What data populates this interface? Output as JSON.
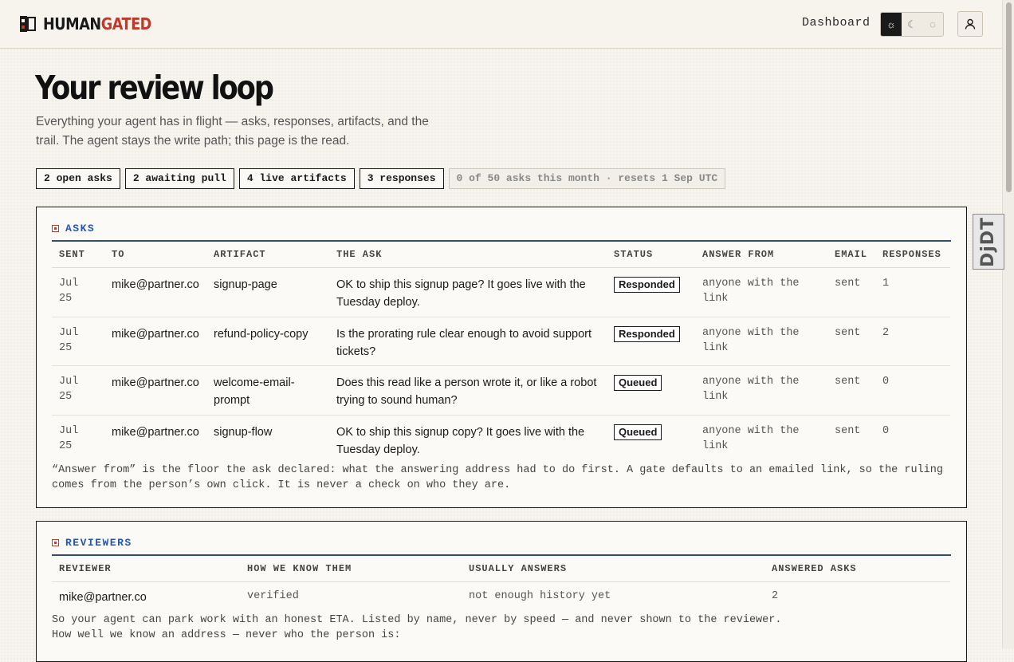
{
  "brand": {
    "part1": "HUMAN",
    "part2": "GATED"
  },
  "nav": {
    "dashboard": "Dashboard"
  },
  "theme": {
    "light": "☼",
    "dark": "☾",
    "system": "◌"
  },
  "page": {
    "title": "Your review loop",
    "lede": "Everything your agent has in flight — asks, responses, artifacts, and the trail. The agent stays the write path; this page is the read."
  },
  "chips": [
    "2 open asks",
    "2 awaiting pull",
    "4 live artifacts",
    "3 responses"
  ],
  "quota": "0 of 50 asks this month · resets 1 Sep UTC",
  "asks": {
    "title": "ASKS",
    "columns": [
      "SENT",
      "TO",
      "ARTIFACT",
      "THE ASK",
      "STATUS",
      "ANSWER FROM",
      "EMAIL",
      "RESPONSES"
    ],
    "rows": [
      {
        "sent": "Jul 25",
        "to": "mike@partner.co",
        "artifact": "signup-page",
        "ask": "OK to ship this signup page? It goes live with the Tuesday deploy.",
        "status": "Responded",
        "answer_from": "anyone with the link",
        "email": "sent",
        "responses": "1"
      },
      {
        "sent": "Jul 25",
        "to": "mike@partner.co",
        "artifact": "refund-policy-copy",
        "ask": "Is the prorating rule clear enough to avoid support tickets?",
        "status": "Responded",
        "answer_from": "anyone with the link",
        "email": "sent",
        "responses": "2"
      },
      {
        "sent": "Jul 25",
        "to": "mike@partner.co",
        "artifact": "welcome-email-prompt",
        "ask": "Does this read like a person wrote it, or like a robot trying to sound human?",
        "status": "Queued",
        "answer_from": "anyone with the link",
        "email": "sent",
        "responses": "0"
      },
      {
        "sent": "Jul 25",
        "to": "mike@partner.co",
        "artifact": "signup-flow",
        "ask": "OK to ship this signup copy? It goes live with the Tuesday deploy.",
        "status": "Queued",
        "answer_from": "anyone with the link",
        "email": "sent",
        "responses": "0"
      }
    ],
    "note": "“Answer from” is the floor the ask declared: what the answering address had to do first. A gate defaults to an emailed link, so the ruling comes from the person’s own click. It is never a check on who they are."
  },
  "reviewers": {
    "title": "REVIEWERS",
    "columns": [
      "REVIEWER",
      "HOW WE KNOW THEM",
      "USUALLY ANSWERS",
      "ANSWERED ASKS"
    ],
    "rows": [
      {
        "reviewer": "mike@partner.co",
        "how": "verified",
        "usually": "not enough history yet",
        "answered": "2"
      }
    ],
    "note1": "So your agent can park work with an honest ETA. Listed by name, never by speed — and never shown to the reviewer.",
    "note2": "How well we know an address — never who the person is:"
  }
}
